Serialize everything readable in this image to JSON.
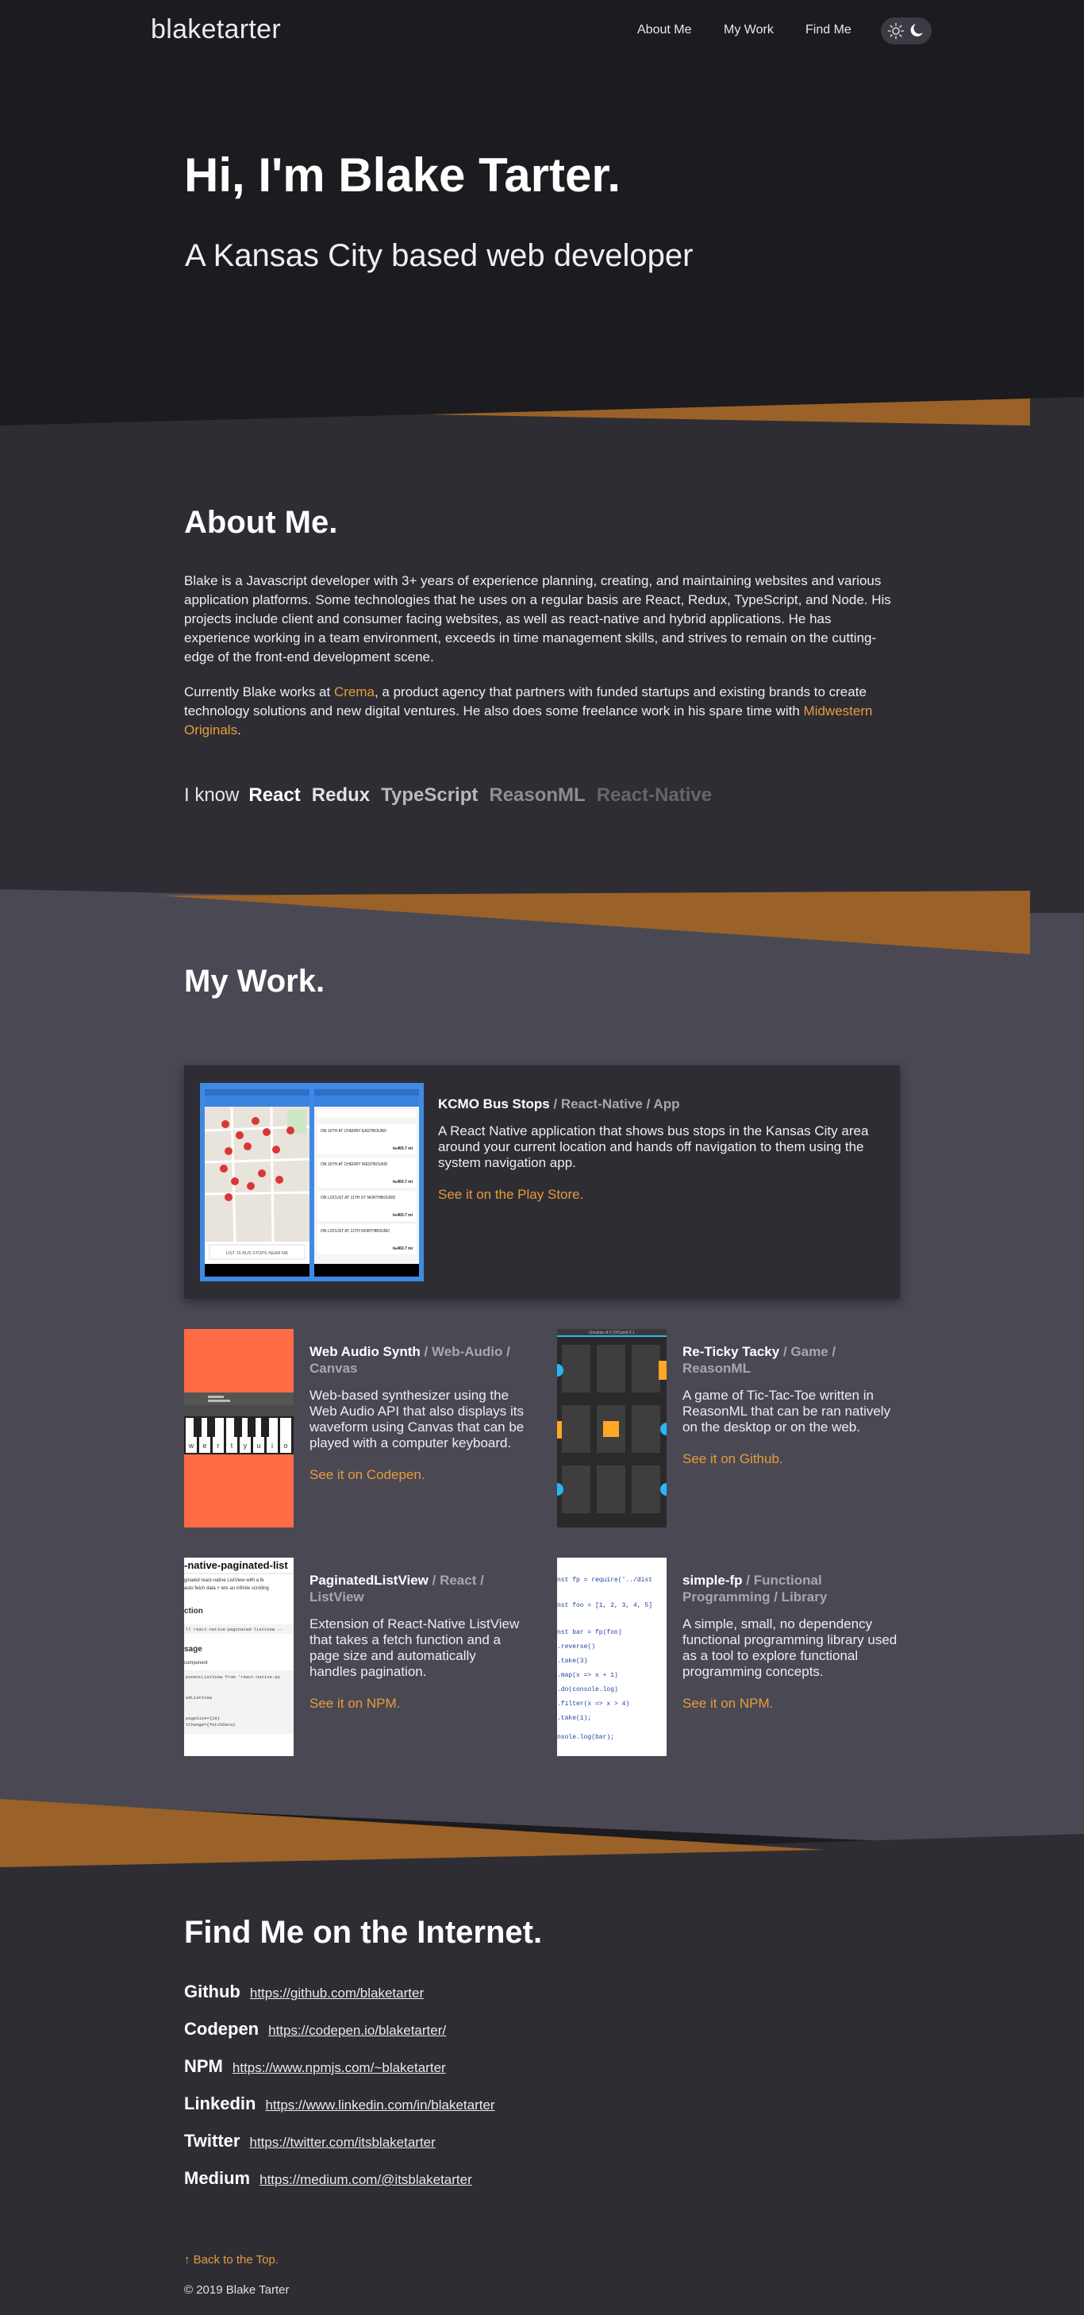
{
  "nav": {
    "brand": "blaketarter",
    "links": [
      "About Me",
      "My Work",
      "Find Me"
    ]
  },
  "hero": {
    "title": "Hi, I'm Blake Tarter.",
    "subtitle": "A Kansas City based web developer"
  },
  "about": {
    "title": "About Me.",
    "paragraph1": "Blake is a Javascript developer with 3+ years of experience planning, creating, and maintaining websites and various application platforms. Some technologies that he uses on a regular basis are React, Redux, TypeScript, and Node. His projects include client and consumer facing websites, as well as react-native and hybrid applications. He has experience working in a team environment, exceeds in time management skills, and strives to remain on the cutting-edge of the front-end development scene.",
    "paragraph2_part1": "Currently Blake works at ",
    "crema_link": "Crema",
    "paragraph2_part2": ", a product agency that partners with funded startups and existing brands to create technology solutions and new digital ventures. He also does some freelance work in his spare time with ",
    "midwestern_link": "Midwestern Originals",
    "paragraph2_part3": ".",
    "skills_lead": "I know",
    "skills": [
      "React",
      "Redux",
      "TypeScript",
      "ReasonML",
      "React-Native"
    ]
  },
  "work": {
    "title": "My Work.",
    "featured": {
      "name": "KCMO Bus Stops",
      "meta": " / React-Native / App",
      "description": "A React Native application that shows bus stops in the Kansas City area around your current location and hands off navigation to them using the system navigation app.",
      "link": "See it on the Play Store.",
      "phone_list": [
        "ON 10TH AT CHERRY EASTBOUND",
        "ON 10TH AT CHERRY WESTBOUND",
        "ON LOCUST AT 11TH ST NORTHBOUND",
        "ON LOCUST AT 12TH NORTHBOUND"
      ],
      "phone_distances": [
        "№460.7 mi",
        "№460.7 mi",
        "№460.7 mi",
        "№460.7 mi"
      ],
      "phone_map_button": "LIST 15 BUS STOPS NEAR ME"
    },
    "projects": [
      {
        "name": "Web Audio Synth",
        "meta": " / Web-Audio / Canvas",
        "description": "Web-based synthesizer using the Web Audio API that also displays its waveform using Canvas that can be played with a computer keyboard.",
        "link": "See it on Codepen.",
        "keys": [
          "w",
          "e",
          "r",
          "t",
          "y",
          "u",
          "i",
          "o"
        ]
      },
      {
        "name": "Re-Ticky Tacky",
        "meta": " / Game / ReasonML",
        "description": "A game of Tic-Tac-Toe written in ReasonML that can be ran natively on the desktop or on the web.",
        "link": "See it on Github.",
        "window_title": "Gravitas of X (OCaml) 0.1"
      },
      {
        "name": "PaginatedListView",
        "meta": " / React / ListView",
        "description": "Extension of React-Native ListView that takes a fetch function and a page size and automatically handles pagination.",
        "link": "See it on NPM.",
        "thumb_heading": "-native-paginated-list",
        "thumb_lines": [
          "ginated react-native ListView with a fe",
          "auto fetch data + lets an infinite scrolling",
          "ction",
          "ll react-native-paginated-listview --",
          "sage",
          "component",
          "ponentListView from 'react-native-pa",
          "",
          "edListView",
          "pageSize={10}",
          "tChange={fetchData}"
        ]
      },
      {
        "name": "simple-fp",
        "meta": " / Functional Programming / Library",
        "description": "A simple, small, no dependency functional programming library used as a tool to explore functional programming concepts.",
        "link": "See it on NPM.",
        "code_lines": [
          "nst fp = require('../dist",
          "nst foo = [1, 2, 3, 4, 5]",
          "nst bar = fp(foo)",
          ".reverse()",
          ".take(3)",
          ".map(x => x + 1)",
          ".do(console.log)",
          ".filter(x => x > 4)",
          ".take(1);",
          "nsole.log(bar);"
        ]
      }
    ]
  },
  "find": {
    "title": "Find Me on the Internet.",
    "links": [
      {
        "name": "Github",
        "url": "https://github.com/blaketarter"
      },
      {
        "name": "Codepen",
        "url": "https://codepen.io/blaketarter/"
      },
      {
        "name": "NPM",
        "url": "https://www.npmjs.com/~blaketarter"
      },
      {
        "name": "Linkedin",
        "url": "https://www.linkedin.com/in/blaketarter"
      },
      {
        "name": "Twitter",
        "url": "https://twitter.com/itsblaketarter"
      },
      {
        "name": "Medium",
        "url": "https://medium.com/@itsblaketarter"
      }
    ]
  },
  "footer": {
    "back_to_top": "↑ Back to the Top.",
    "copyright": "© 2019 Blake Tarter"
  },
  "colors": {
    "background": "#1c1b1f",
    "section_dark": "#2e2d34",
    "section_mid": "#4a4853",
    "accent": "#e79c3a",
    "band_orange": "#a76a2c"
  }
}
